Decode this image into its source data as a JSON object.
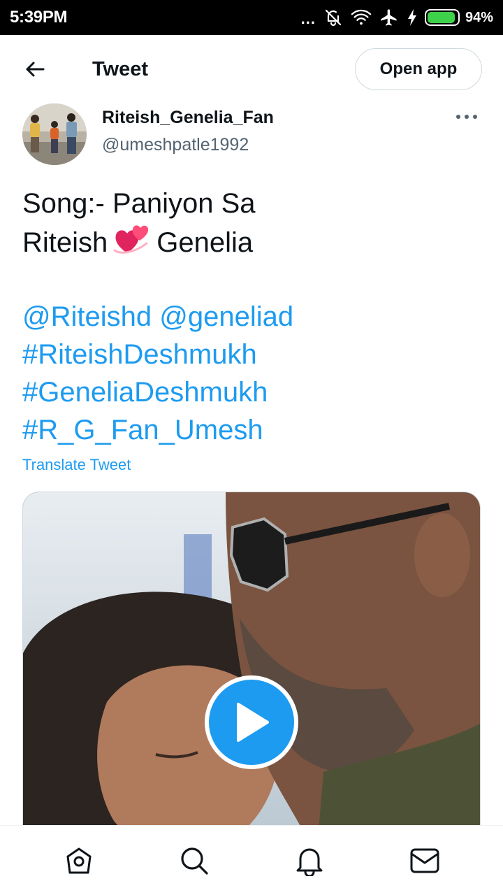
{
  "status_bar": {
    "time": "5:39PM",
    "dots": "...",
    "icons": [
      "mute-icon",
      "wifi-icon",
      "airplane-icon",
      "charging-icon"
    ],
    "battery_percent": "94%",
    "battery_level": 0.94,
    "battery_color": "#3ed14a"
  },
  "header": {
    "title": "Tweet",
    "open_app_label": "Open app"
  },
  "author": {
    "name": "Riteish_Genelia_Fan",
    "handle": "@umeshpatle1992"
  },
  "tweet": {
    "line1": "Song:- Paniyon Sa",
    "line2_before": "Riteish",
    "line2_emoji": "two-hearts-emoji",
    "line2_after": "Genelia",
    "mention1": "@Riteishd",
    "mention2": "@geneliad",
    "hashtag1": "#RiteishDeshmukh",
    "hashtag2": "#GeneliaDeshmukh",
    "hashtag3": "#R_G_Fan_Umesh",
    "translate_label": "Translate Tweet",
    "link_color": "#1d9bf0"
  },
  "media": {
    "type": "video",
    "overlay": "play-icon"
  },
  "bottom_nav": {
    "items": [
      "home-icon",
      "search-icon",
      "notifications-icon",
      "messages-icon"
    ]
  }
}
